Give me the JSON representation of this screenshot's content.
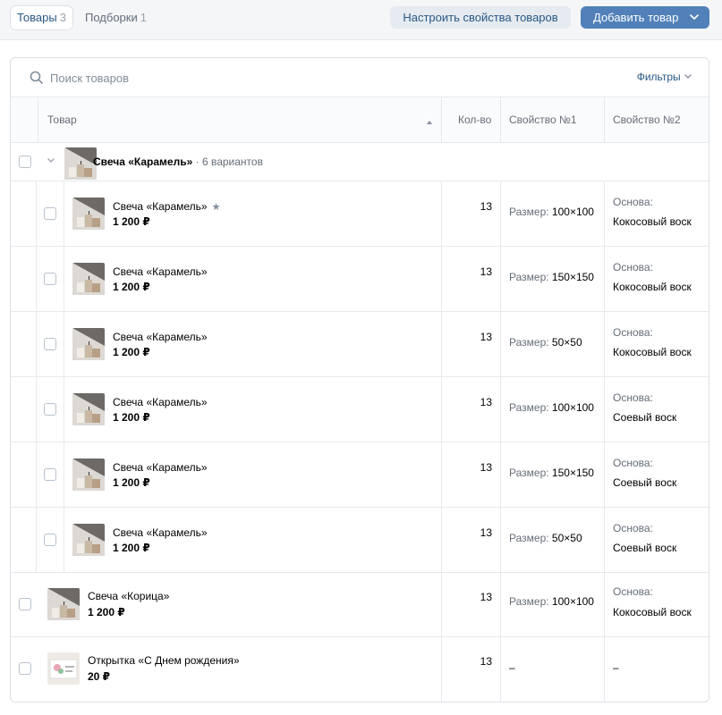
{
  "tabs": [
    {
      "label": "Товары",
      "count": "3"
    },
    {
      "label": "Подборки",
      "count": "1"
    }
  ],
  "toolbar": {
    "settings_label": "Настроить свойства товаров",
    "add_label": "Добавить товар"
  },
  "search": {
    "placeholder": "Поиск товаров",
    "filters_label": "Фильтры"
  },
  "columns": {
    "product": "Товар",
    "qty": "Кол-во",
    "prop1": "Свойство №1",
    "prop2": "Свойство №2"
  },
  "group": {
    "name": "Свеча «Карамель»",
    "variants": "· 6 вариантов"
  },
  "variants": [
    {
      "name": "Свеча «Карамель»",
      "price": "1 200 ₽",
      "qty": "13",
      "p1_label": "Размер:",
      "p1_value": "100×100",
      "p2_label": "Основа:",
      "p2_value": "Кокосовый воск"
    },
    {
      "name": "Свеча «Карамель»",
      "price": "1 200 ₽",
      "qty": "13",
      "p1_label": "Размер:",
      "p1_value": "150×150",
      "p2_label": "Основа:",
      "p2_value": "Кокосовый воск"
    },
    {
      "name": "Свеча «Карамель»",
      "price": "1 200 ₽",
      "qty": "13",
      "p1_label": "Размер:",
      "p1_value": "50×50",
      "p2_label": "Основа:",
      "p2_value": "Кокосовый воск"
    },
    {
      "name": "Свеча «Карамель»",
      "price": "1 200 ₽",
      "qty": "13",
      "p1_label": "Размер:",
      "p1_value": "100×100",
      "p2_label": "Основа:",
      "p2_value": "Соевый воск"
    },
    {
      "name": "Свеча «Карамель»",
      "price": "1 200 ₽",
      "qty": "13",
      "p1_label": "Размер:",
      "p1_value": "150×150",
      "p2_label": "Основа:",
      "p2_value": "Соевый воск"
    },
    {
      "name": "Свеча «Карамель»",
      "price": "1 200 ₽",
      "qty": "13",
      "p1_label": "Размер:",
      "p1_value": "50×50",
      "p2_label": "Основа:",
      "p2_value": "Соевый воск"
    }
  ],
  "products": [
    {
      "name": "Свеча «Корица»",
      "price": "1 200 ₽",
      "qty": "13",
      "p1_label": "Размер:",
      "p1_value": "100×100",
      "p2_label": "Основа:",
      "p2_value": "Кокосовый воск"
    },
    {
      "name": "Открытка «С Днем рождения»",
      "price": "20 ₽",
      "qty": "13",
      "p1_value": "–",
      "p2_value": "–"
    }
  ],
  "colors": {
    "accent": "#5181b8",
    "link": "#2a5885",
    "secondary": "#e5ebf1"
  }
}
